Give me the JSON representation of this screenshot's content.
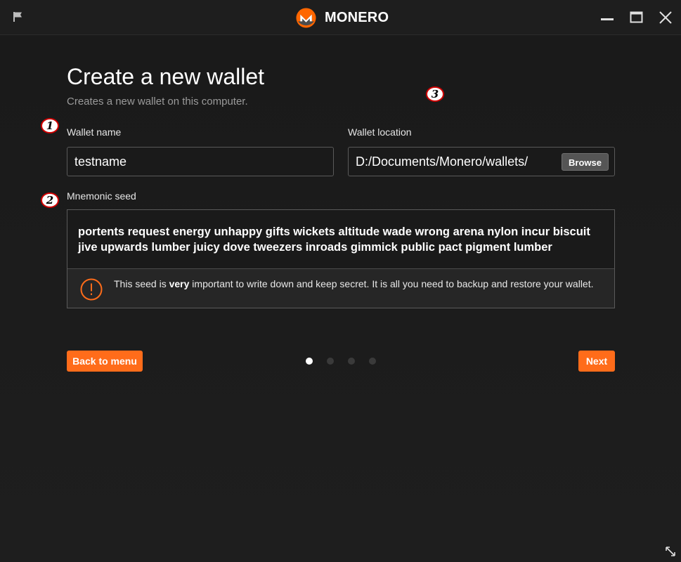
{
  "titlebar": {
    "brand_name": "MONERO",
    "brand_color": "#ff6600",
    "icons": {
      "flag": "flag-icon",
      "minimize": "minimize-icon",
      "maximize": "maximize-icon",
      "close": "close-icon",
      "logo": "monero-logo-icon"
    }
  },
  "page": {
    "title": "Create a new wallet",
    "subtitle": "Creates a new wallet on this computer."
  },
  "form": {
    "wallet_name_label": "Wallet name",
    "wallet_name_value": "testname",
    "wallet_location_label": "Wallet location",
    "wallet_location_value": "D:/Documents/Monero/wallets/",
    "browse_label": "Browse"
  },
  "seed": {
    "label": "Mnemonic seed",
    "words": "portents request energy unhappy gifts wickets altitude wade wrong arena nylon incur biscuit jive upwards lumber juicy dove tweezers inroads gimmick public pact pigment lumber",
    "warning_before": "This seed is ",
    "warning_emphasis": "very",
    "warning_after": " important to write down and keep secret. It is all you need to backup and restore your wallet.",
    "warning_icon": "warning-icon"
  },
  "navigation": {
    "back_label": "Back to menu",
    "next_label": "Next",
    "steps_total": 4,
    "current_step": 1
  },
  "annotations": [
    "1",
    "2",
    "3"
  ],
  "colors": {
    "accent": "#ff6c1a",
    "background": "#1c1c1c",
    "annotation_border": "#d00000"
  }
}
